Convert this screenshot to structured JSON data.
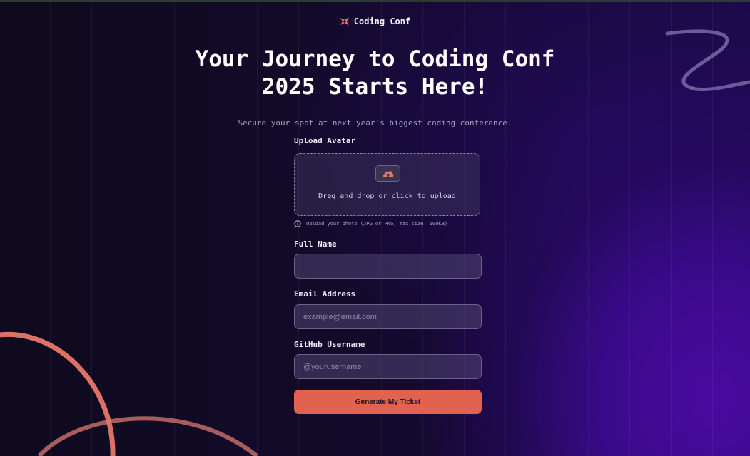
{
  "brand": {
    "name": "Coding Conf",
    "icon": "conf-logo-icon"
  },
  "hero": {
    "title_line1": "Your Journey to Coding Conf",
    "title_line2": "2025 Starts Here!",
    "subtitle": "Secure your spot at next year's biggest coding conference."
  },
  "form": {
    "avatar_label": "Upload Avatar",
    "upload_text": "Drag and drop or click to upload",
    "upload_icon": "cloud-upload-icon",
    "upload_hint": "Upload your photo (JPG or PNG, max size: 500KB)",
    "hint_icon": "info-icon",
    "fullname_label": "Full Name",
    "fullname_value": "",
    "email_label": "Email Address",
    "email_placeholder": "example@email.com",
    "github_label": "GitHub Username",
    "github_placeholder": "@yourusername",
    "submit_label": "Generate My Ticket"
  },
  "colors": {
    "accent": "#e0624f",
    "background": "#0d0720",
    "purple_glow": "#4a0aa0"
  }
}
